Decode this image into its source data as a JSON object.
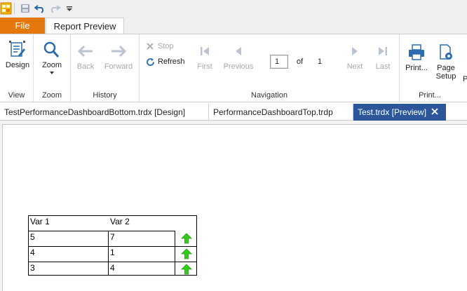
{
  "ribbon_tabs": {
    "file": "File",
    "report_preview": "Report Preview"
  },
  "groups": {
    "view": {
      "label": "View",
      "design": "Design"
    },
    "zoom": {
      "label": "Zoom",
      "zoom": "Zoom"
    },
    "history": {
      "label": "History",
      "back": "Back",
      "forward": "Forward"
    },
    "navigation": {
      "label": "Navigation",
      "stop": "Stop",
      "refresh": "Refresh",
      "first": "First",
      "previous": "Previous",
      "page_value": "1",
      "of": "of",
      "total_pages": "1",
      "next": "Next",
      "last": "Last"
    },
    "print": {
      "label": "Print...",
      "print": "Print...",
      "page_setup_line1": "Page",
      "page_setup_line2": "Setup",
      "partial": "P"
    }
  },
  "document_tabs": [
    {
      "label": "TestPerformanceDashboardBottom.trdx [Design]",
      "active": false
    },
    {
      "label": "PerformanceDashboardTop.trdp",
      "active": false
    },
    {
      "label": "Test.trdx [Preview]",
      "active": true
    }
  ],
  "report_table": {
    "headers": [
      "Var 1",
      "Var 2"
    ],
    "rows": [
      {
        "var1": "5",
        "var2": "7",
        "indicator": "green-up-arrow-icon"
      },
      {
        "var1": "4",
        "var2": "1",
        "indicator": "green-up-arrow-icon"
      },
      {
        "var1": "3",
        "var2": "4",
        "indicator": "green-up-arrow-icon"
      }
    ]
  },
  "colors": {
    "file_tab": "#e4780c",
    "active_doc_tab": "#2b579a",
    "icon_blue": "#2b6cb0",
    "arrow_green": "#33cc1a"
  }
}
